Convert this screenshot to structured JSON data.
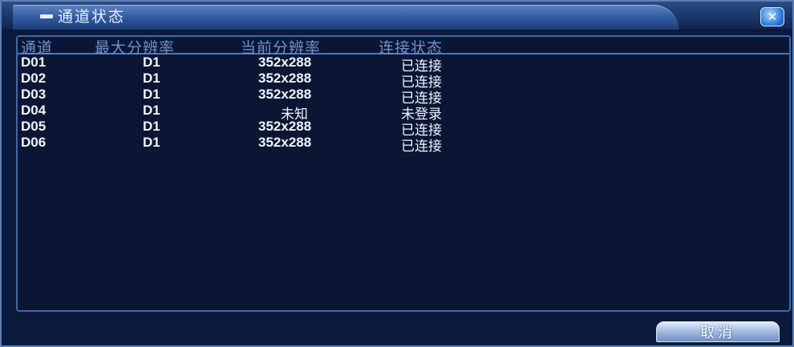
{
  "window": {
    "title": "通道状态",
    "close_symbol": "✕"
  },
  "table": {
    "headers": [
      "通道",
      "最大分辨率",
      "当前分辨率",
      "连接状态"
    ],
    "rows": [
      {
        "channel": "D01",
        "max_res": "D1",
        "cur_res": "352x288",
        "status": "已连接"
      },
      {
        "channel": "D02",
        "max_res": "D1",
        "cur_res": "352x288",
        "status": "已连接"
      },
      {
        "channel": "D03",
        "max_res": "D1",
        "cur_res": "352x288",
        "status": "已连接"
      },
      {
        "channel": "D04",
        "max_res": "D1",
        "cur_res": "未知",
        "status": "未登录"
      },
      {
        "channel": "D05",
        "max_res": "D1",
        "cur_res": "352x288",
        "status": "已连接"
      },
      {
        "channel": "D06",
        "max_res": "D1",
        "cur_res": "352x288",
        "status": "已连接"
      }
    ]
  },
  "footer": {
    "cancel_label": "取消"
  },
  "colors": {
    "background": "#0b1a3c",
    "accent": "#3d6aa8",
    "text": "#f2f4fa",
    "header_text": "#6f90c8"
  }
}
